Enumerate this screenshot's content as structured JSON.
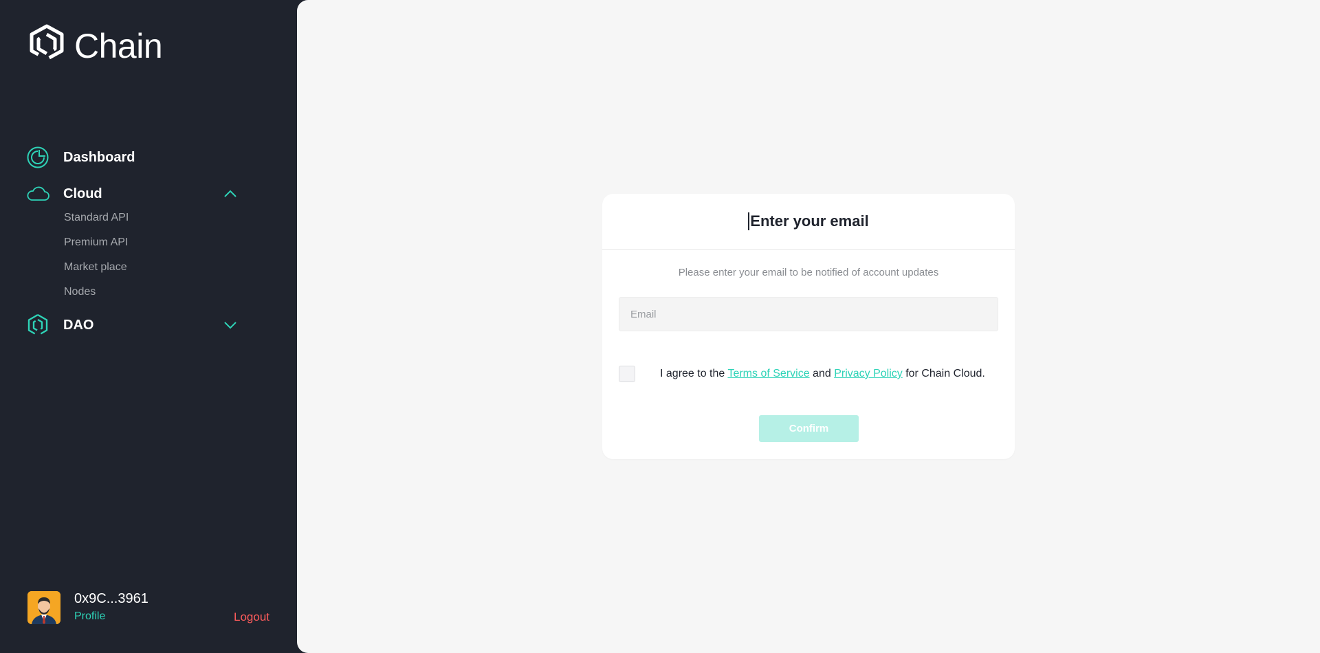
{
  "brand": {
    "name": "Chain",
    "accent_color": "#2ed3b7",
    "sidebar_bg": "#1f232d"
  },
  "sidebar": {
    "nav": [
      {
        "label": "Dashboard",
        "icon": "dashboard-icon"
      },
      {
        "label": "Cloud",
        "icon": "cloud-icon",
        "expanded": true,
        "chevron": "chevron-up-icon",
        "children": [
          "Standard API",
          "Premium API",
          "Market place",
          "Nodes"
        ]
      },
      {
        "label": "DAO",
        "icon": "dao-icon",
        "expanded": false,
        "chevron": "chevron-down-icon"
      }
    ],
    "user": {
      "address": "0x9C...3961",
      "profile_label": "Profile",
      "logout_label": "Logout"
    }
  },
  "card": {
    "title": "Enter your email",
    "description": "Please enter your email to be notified of account updates",
    "email_placeholder": "Email",
    "email_value": "",
    "agree": {
      "prefix": "I agree to the ",
      "terms_link": "Terms of Service",
      "middle": " and ",
      "privacy_link": "Privacy Policy",
      "suffix": " for Chain Cloud.",
      "checked": false
    },
    "confirm_label": "Confirm",
    "confirm_disabled": true,
    "confirm_color": "#b6f0e6"
  }
}
